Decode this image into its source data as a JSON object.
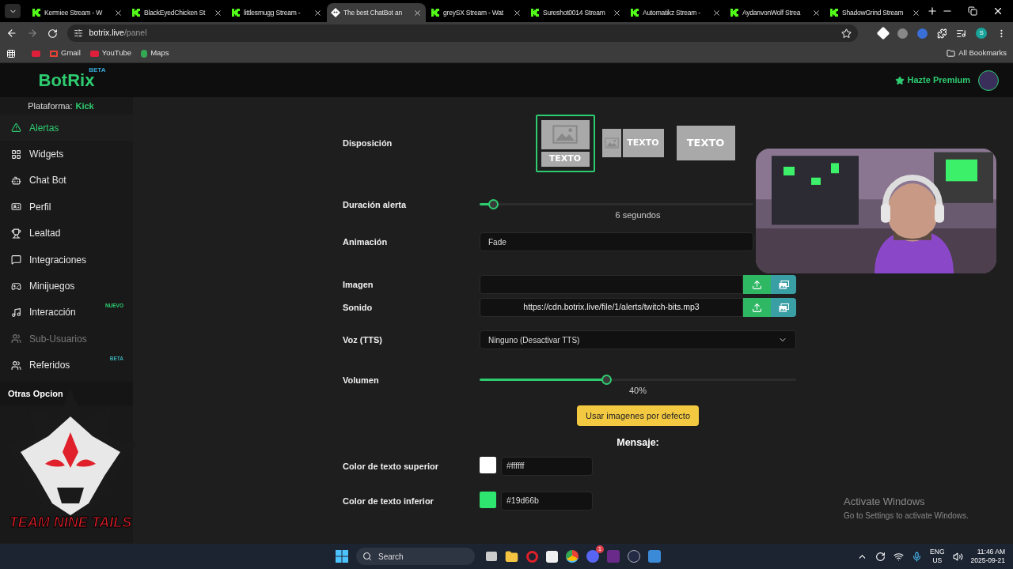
{
  "browser": {
    "tabs": [
      {
        "title": "Kermiee Stream - W",
        "selected": false
      },
      {
        "title": "BlackEyedChicken St",
        "selected": false
      },
      {
        "title": "littlesmugg Stream - ",
        "selected": false
      },
      {
        "title": "The best ChatBot an",
        "selected": true
      },
      {
        "title": "greySX Stream - Wat",
        "selected": false
      },
      {
        "title": "Sureshot0014 Stream",
        "selected": false
      },
      {
        "title": "Automatikz Stream - ",
        "selected": false
      },
      {
        "title": "AydanvonWolf Strea",
        "selected": false
      },
      {
        "title": "ShadowGrind Stream",
        "selected": false
      }
    ],
    "url_host": "botrix.live",
    "url_path": "/panel",
    "bookmarks": [
      "Gmail",
      "YouTube",
      "Maps"
    ],
    "all_bookmarks": "All Bookmarks",
    "profile_initial": "S"
  },
  "header": {
    "logo": "BotRix",
    "logo_badge": "BETA",
    "premium": "Hazte Premium"
  },
  "sidebar": {
    "platform_label": "Plataforma:",
    "platform": "Kick",
    "items": [
      {
        "label": "Alertas",
        "selected": true,
        "disabled": false
      },
      {
        "label": "Widgets",
        "selected": false,
        "disabled": false
      },
      {
        "label": "Chat Bot",
        "selected": false,
        "disabled": false
      },
      {
        "label": "Perfil",
        "selected": false,
        "disabled": false
      },
      {
        "label": "Lealtad",
        "selected": false,
        "disabled": false
      },
      {
        "label": "Integraciones",
        "selected": false,
        "disabled": false
      },
      {
        "label": "Minijuegos",
        "selected": false,
        "disabled": false
      },
      {
        "label": "Interacción",
        "selected": false,
        "disabled": false,
        "badge": "NUEVO",
        "color": "#2ecc71"
      },
      {
        "label": "Sub-Usuarios",
        "selected": false,
        "disabled": true
      },
      {
        "label": "Referidos",
        "selected": false,
        "disabled": false,
        "badge": "BETA",
        "color": "#3aa9b0"
      }
    ],
    "section": "Otras Opcion"
  },
  "form": {
    "layout": {
      "label": "Disposición",
      "options": [
        {
          "kind": "stacked",
          "text": "TEXTO",
          "selected": true
        },
        {
          "kind": "inline",
          "text": "TEXTO",
          "selected": false
        },
        {
          "kind": "overlay",
          "text": "TEXTO",
          "selected": false
        }
      ]
    },
    "duration": {
      "label": "Duración alerta",
      "level": 0.05,
      "reading": "6 segundos"
    },
    "animation": {
      "label": "Animación",
      "value": "Fade"
    },
    "image": {
      "label": "Imagen"
    },
    "sound": {
      "label": "Sonido",
      "value": "https://cdn.botrix.live/file/1/alerts/twitch-bits.mp3"
    },
    "tts": {
      "label": "Voz (TTS)",
      "value": "Ninguno (Desactivar TTS)"
    },
    "volume": {
      "label": "Volumen",
      "level": 0.4,
      "reading": "40%"
    },
    "default_button": "Usar imagenes por defecto",
    "message_heading": "Mensaje:",
    "colors": [
      {
        "label": "Color de texto superior",
        "color": "#ffffff",
        "value": "#ffffff"
      },
      {
        "label": "Color de texto inferior",
        "color": "#2ee66f",
        "value": "#19d66b"
      }
    ]
  },
  "overlays": {
    "team_logo": {
      "text": "TEAM NINE TAILS"
    }
  },
  "activation_notice": {
    "title": "Activate Windows",
    "text": "Go to Settings to activate Windows."
  },
  "taskbar": {
    "search": "Search",
    "notification_count": "1",
    "language": "ENG",
    "region": "US",
    "time": "11:46 AM",
    "date": "2025-09-21"
  }
}
